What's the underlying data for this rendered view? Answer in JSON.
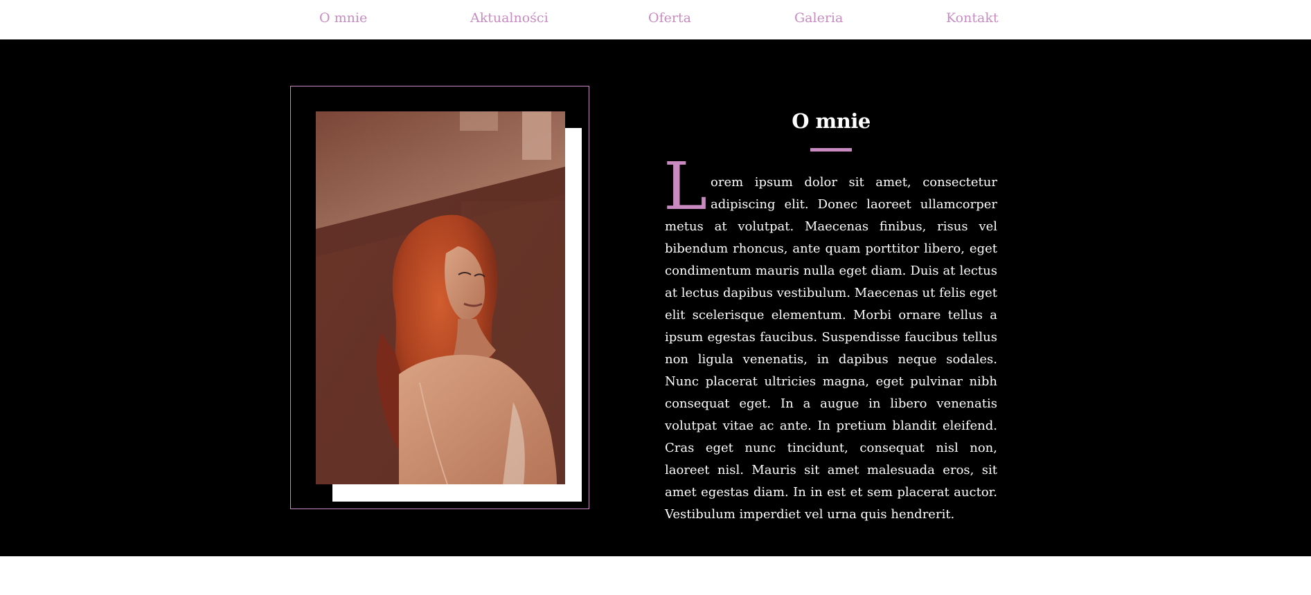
{
  "nav": {
    "items": [
      {
        "label": "O mnie"
      },
      {
        "label": "Aktualności"
      },
      {
        "label": "Oferta"
      },
      {
        "label": "Galeria"
      },
      {
        "label": "Kontakt"
      }
    ]
  },
  "about": {
    "title": "O mnie",
    "drop_cap": "L",
    "paragraph": "orem ipsum dolor sit amet, consectetur adipiscing elit. Donec laoreet ullamcorper metus at volutpat. Maecenas finibus, risus vel bibendum rhoncus, ante quam porttitor libero, eget condimentum mauris nulla eget diam. Duis at lectus at lectus dapibus vestibulum. Maecenas ut felis eget elit scelerisque elementum. Morbi ornare tellus a ipsum egestas faucibus. Suspendisse faucibus tellus non ligula venenatis, in dapibus neque sodales. Nunc placerat ultricies magna, eget pulvinar nibh consequat eget. In a augue in libero venenatis volutpat vitae ac ante. In pretium blandit eleifend. Cras eget nunc tincidunt, consequat nisl non, laoreet nisl. Mauris sit amet malesuada eros, sit amet egestas diam. In in est et sem placerat auctor. Vestibulum imperdiet vel urna quis hendrerit."
  },
  "colors": {
    "accent": "#c98ac2",
    "background": "#000000",
    "text": "#ffffff",
    "nav_background": "#ffffff"
  }
}
